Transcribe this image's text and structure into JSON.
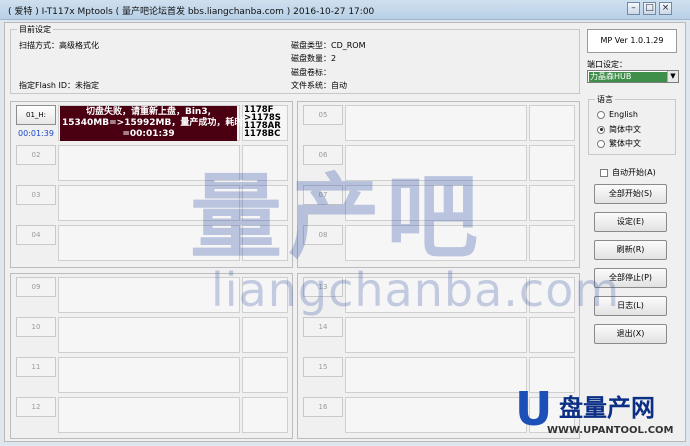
{
  "window": {
    "title": "( 爱特 ) I-T117x Mptools ( 量产吧论坛首发 bbs.liangchanba.com )      2016-10-27 17:00",
    "min_label": "–",
    "max_label": "□",
    "close_label": "×"
  },
  "target_settings": {
    "legend": "目前设定",
    "scan_mode": "扫描方式：高级格式化",
    "flash_id": "指定Flash ID：未指定",
    "disk_type": "磁盘类型：CD_ROM",
    "disk_count": "磁盘数量：2",
    "disk_label": "磁盘卷标：",
    "file_system": "文件系统：自动"
  },
  "slots": [
    {
      "id": "01_H:",
      "active": true,
      "time": "00:01:39",
      "message": [
        "切盘失败，请重新上盘，Bin3,",
        "15340MB=>15992MB，量产成功，耗时",
        "=00:01:39"
      ],
      "log": [
        "1178F",
        ">1178S",
        "1178AR",
        "1178BC"
      ]
    },
    {
      "id": "02"
    },
    {
      "id": "03"
    },
    {
      "id": "04"
    },
    {
      "id": "05"
    },
    {
      "id": "06"
    },
    {
      "id": "07"
    },
    {
      "id": "08"
    },
    {
      "id": "09"
    },
    {
      "id": "10"
    },
    {
      "id": "11"
    },
    {
      "id": "12"
    },
    {
      "id": "13"
    },
    {
      "id": "14"
    },
    {
      "id": "15"
    },
    {
      "id": "16"
    }
  ],
  "side": {
    "version": "MP Ver 1.0.1.29",
    "port_label": "端口设定：",
    "port_value": "力晶森HUB",
    "language_legend": "语言",
    "languages": [
      "English",
      "简体中文",
      "繁体中文"
    ],
    "selected_language": 1,
    "auto_start": "自动开始(A)",
    "buttons": [
      "全部开始(S)",
      "设定(E)",
      "刷新(R)",
      "全部停止(P)",
      "日志(L)",
      "退出(X)"
    ]
  },
  "watermark": {
    "title": "量产吧",
    "url": "liangchanba.com"
  },
  "logo": {
    "mark": "U",
    "name": "盘量产网",
    "url": "WWW.UPANTOOL.COM"
  }
}
